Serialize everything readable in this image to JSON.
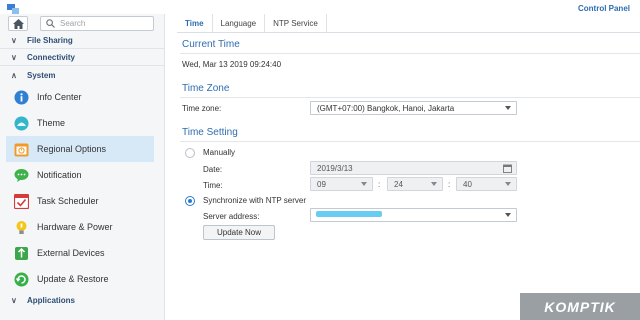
{
  "window": {
    "title": "Control Panel",
    "accent": "#2c6db0"
  },
  "search": {
    "placeholder": "Search"
  },
  "sidebar": {
    "sections": [
      {
        "label": "File Sharing",
        "state": "collapsed"
      },
      {
        "label": "Connectivity",
        "state": "collapsed"
      },
      {
        "label": "System",
        "state": "expanded"
      },
      {
        "label": "Applications",
        "state": "collapsed"
      }
    ],
    "items": [
      {
        "label": "Info Center",
        "icon": "info-icon"
      },
      {
        "label": "Theme",
        "icon": "theme-icon"
      },
      {
        "label": "Regional Options",
        "icon": "regional-options-icon",
        "active": true
      },
      {
        "label": "Notification",
        "icon": "notification-icon"
      },
      {
        "label": "Task Scheduler",
        "icon": "task-scheduler-icon"
      },
      {
        "label": "Hardware & Power",
        "icon": "hardware-power-icon"
      },
      {
        "label": "External Devices",
        "icon": "external-devices-icon"
      },
      {
        "label": "Update & Restore",
        "icon": "update-restore-icon"
      }
    ]
  },
  "tabs": [
    {
      "label": "Time",
      "active": true
    },
    {
      "label": "Language"
    },
    {
      "label": "NTP Service"
    }
  ],
  "current_time": {
    "heading": "Current Time",
    "value": "Wed, Mar 13 2019 09:24:40"
  },
  "time_zone": {
    "heading": "Time Zone",
    "label": "Time zone:",
    "value": "(GMT+07:00) Bangkok, Hanoi, Jakarta"
  },
  "time_setting": {
    "heading": "Time Setting",
    "manually_label": "Manually",
    "date_label": "Date:",
    "date_value": "2019/3/13",
    "time_label": "Time:",
    "hour": "09",
    "minute": "24",
    "second": "40",
    "separator": ":",
    "ntp_label": "Synchronize with NTP server",
    "server_label": "Server address:",
    "update_button": "Update Now"
  },
  "watermark": {
    "text": "KOMPTIK"
  }
}
